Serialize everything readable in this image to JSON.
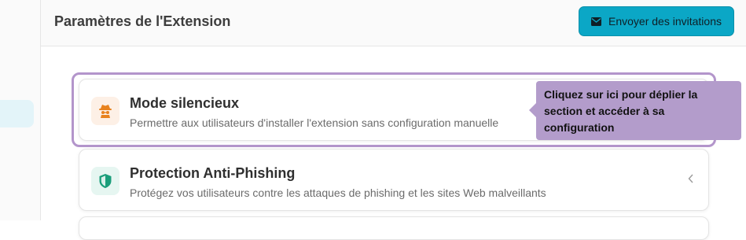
{
  "header": {
    "title": "Paramètres de l'Extension",
    "invite_button": {
      "label": "Envoyer des invitations",
      "icon": "envelope-icon"
    }
  },
  "settings": [
    {
      "title": "Mode silencieux",
      "description": "Permettre aux utilisateurs d'installer l'extension sans configuration manuelle",
      "icon": "incognito-icon",
      "icon_color": "#e8821e"
    },
    {
      "title": "Protection Anti-Phishing",
      "description": "Protégez vos utilisateurs contre les attaques de phishing et les sites Web malveillants",
      "icon": "shield-icon",
      "icon_color": "#1a9e7a"
    }
  ],
  "tooltip": {
    "text": "Cliquez sur ici pour déplier la section et accéder à sa configuration"
  },
  "colors": {
    "accent": "#0ba7c6",
    "highlight": "#b395cb",
    "tooltip_bg": "#b39ccb"
  }
}
